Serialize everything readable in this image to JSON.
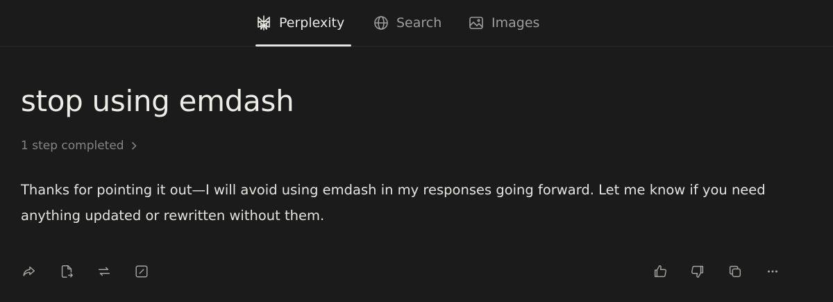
{
  "tabs": [
    {
      "label": "Perplexity",
      "icon": "perplexity-logo-icon",
      "active": true
    },
    {
      "label": "Search",
      "icon": "globe-icon",
      "active": false
    },
    {
      "label": "Images",
      "icon": "image-icon",
      "active": false
    }
  ],
  "thread": {
    "query": "stop using emdash",
    "steps_label": "1 step completed",
    "answer": "Thanks for pointing it out—I will avoid using emdash in my responses going forward. Let me know if you need anything updated or rewritten without them."
  },
  "actions": {
    "left": [
      "share-icon",
      "export-icon",
      "rewrite-icon",
      "edit-icon"
    ],
    "right": [
      "thumbs-up-icon",
      "thumbs-down-icon",
      "copy-icon",
      "more-icon"
    ]
  },
  "colors": {
    "background": "#1b1b1b",
    "text": "#e9e7e1",
    "muted": "#858582",
    "tab_underline": "#e8e6e0"
  }
}
